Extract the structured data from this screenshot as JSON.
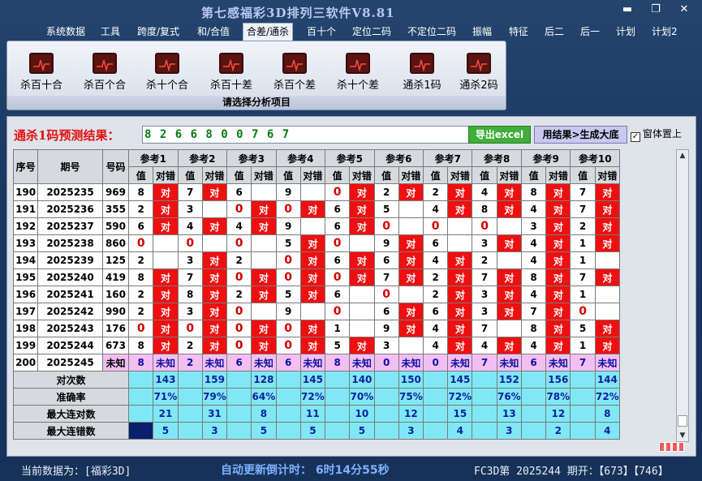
{
  "app": {
    "title": "第七感福彩3D排列三软件V8.81"
  },
  "window_controls": {
    "min": "▬",
    "max": "❐",
    "close": "✕"
  },
  "menu": [
    "系统数据",
    "工具",
    "跨度/复式",
    "和/合值",
    "合差/通杀",
    "百十个",
    "定位二码",
    "不定位二码",
    "振幅",
    "特征",
    "后二",
    "后一",
    "计划",
    "计划2"
  ],
  "ribbon": {
    "buttons": [
      "杀百十合",
      "杀百个合",
      "杀十个合",
      "杀百十差",
      "杀百个差",
      "杀十个差",
      "通杀1码",
      "通杀2码"
    ],
    "caption": "请选择分析项目"
  },
  "prediction": {
    "label": "通杀1码预测结果：",
    "value": "8 2 6 6 8 0 0 7 6 7",
    "export_label": "导出excel",
    "generate_label": "用结果>生成大底",
    "topmost_label": "窗体置上",
    "topmost_checked": "✓"
  },
  "table": {
    "headers": {
      "seq": "序号",
      "issue": "期号",
      "number": "号码",
      "value": "值",
      "hit": "对错"
    },
    "ref_titles": [
      "参考1",
      "参考2",
      "参考3",
      "参考4",
      "参考5",
      "参考6",
      "参考7",
      "参考8",
      "参考9",
      "参考10"
    ],
    "hit_mark": "对",
    "rows": [
      {
        "seq": "190",
        "issue": "2025235",
        "num": "969",
        "refs": [
          [
            "8",
            1
          ],
          [
            "7",
            1
          ],
          [
            "6",
            0
          ],
          [
            "9",
            0
          ],
          [
            "0",
            1
          ],
          [
            "2",
            1
          ],
          [
            "2",
            1
          ],
          [
            "4",
            1
          ],
          [
            "8",
            1
          ],
          [
            "7",
            1
          ]
        ]
      },
      {
        "seq": "191",
        "issue": "2025236",
        "num": "355",
        "refs": [
          [
            "2",
            1
          ],
          [
            "3",
            0
          ],
          [
            "0",
            1
          ],
          [
            "0",
            1
          ],
          [
            "6",
            1
          ],
          [
            "5",
            0
          ],
          [
            "4",
            1
          ],
          [
            "8",
            1
          ],
          [
            "4",
            1
          ],
          [
            "7",
            1
          ]
        ]
      },
      {
        "seq": "192",
        "issue": "2025237",
        "num": "590",
        "refs": [
          [
            "6",
            1
          ],
          [
            "4",
            1
          ],
          [
            "4",
            1
          ],
          [
            "9",
            0
          ],
          [
            "6",
            1
          ],
          [
            "0",
            0
          ],
          [
            "0",
            0
          ],
          [
            "0",
            0
          ],
          [
            "3",
            1
          ],
          [
            "2",
            1
          ]
        ]
      },
      {
        "seq": "193",
        "issue": "2025238",
        "num": "860",
        "refs": [
          [
            "0",
            0
          ],
          [
            "0",
            0
          ],
          [
            "0",
            0
          ],
          [
            "5",
            1
          ],
          [
            "0",
            0
          ],
          [
            "9",
            1
          ],
          [
            "6",
            0
          ],
          [
            "3",
            1
          ],
          [
            "4",
            1
          ],
          [
            "1",
            1
          ]
        ]
      },
      {
        "seq": "194",
        "issue": "2025239",
        "num": "125",
        "refs": [
          [
            "2",
            0
          ],
          [
            "3",
            1
          ],
          [
            "2",
            0
          ],
          [
            "0",
            1
          ],
          [
            "6",
            1
          ],
          [
            "6",
            1
          ],
          [
            "4",
            1
          ],
          [
            "2",
            0
          ],
          [
            "4",
            1
          ],
          [
            "1",
            0
          ]
        ]
      },
      {
        "seq": "195",
        "issue": "2025240",
        "num": "419",
        "refs": [
          [
            "8",
            1
          ],
          [
            "7",
            1
          ],
          [
            "0",
            1
          ],
          [
            "0",
            1
          ],
          [
            "0",
            1
          ],
          [
            "7",
            1
          ],
          [
            "2",
            1
          ],
          [
            "7",
            1
          ],
          [
            "8",
            1
          ],
          [
            "7",
            1
          ]
        ]
      },
      {
        "seq": "196",
        "issue": "2025241",
        "num": "160",
        "refs": [
          [
            "2",
            1
          ],
          [
            "8",
            1
          ],
          [
            "2",
            1
          ],
          [
            "5",
            1
          ],
          [
            "6",
            0
          ],
          [
            "0",
            0
          ],
          [
            "2",
            1
          ],
          [
            "3",
            1
          ],
          [
            "4",
            1
          ],
          [
            "1",
            0
          ]
        ]
      },
      {
        "seq": "197",
        "issue": "2025242",
        "num": "990",
        "refs": [
          [
            "2",
            1
          ],
          [
            "3",
            1
          ],
          [
            "0",
            0
          ],
          [
            "9",
            0
          ],
          [
            "0",
            0
          ],
          [
            "6",
            1
          ],
          [
            "6",
            1
          ],
          [
            "3",
            1
          ],
          [
            "7",
            1
          ],
          [
            "0",
            0
          ]
        ]
      },
      {
        "seq": "198",
        "issue": "2025243",
        "num": "176",
        "refs": [
          [
            "0",
            1
          ],
          [
            "0",
            1
          ],
          [
            "0",
            1
          ],
          [
            "0",
            1
          ],
          [
            "1",
            0
          ],
          [
            "9",
            1
          ],
          [
            "4",
            1
          ],
          [
            "7",
            0
          ],
          [
            "8",
            1
          ],
          [
            "5",
            1
          ]
        ]
      },
      {
        "seq": "199",
        "issue": "2025244",
        "num": "673",
        "refs": [
          [
            "8",
            1
          ],
          [
            "2",
            1
          ],
          [
            "0",
            1
          ],
          [
            "0",
            1
          ],
          [
            "5",
            1
          ],
          [
            "3",
            0
          ],
          [
            "4",
            1
          ],
          [
            "4",
            1
          ],
          [
            "4",
            1
          ],
          [
            "1",
            1
          ]
        ]
      }
    ],
    "pending": {
      "seq": "200",
      "issue": "2025245",
      "num": "未知",
      "unknown": "未知",
      "values": [
        "8",
        "2",
        "6",
        "6",
        "8",
        "0",
        "0",
        "7",
        "6",
        "7"
      ]
    },
    "stats": [
      {
        "label": "对次数",
        "values": [
          "143",
          "159",
          "128",
          "145",
          "140",
          "150",
          "145",
          "152",
          "156",
          "144"
        ]
      },
      {
        "label": "准确率",
        "values": [
          "71%",
          "79%",
          "64%",
          "72%",
          "70%",
          "75%",
          "72%",
          "76%",
          "78%",
          "72%"
        ]
      },
      {
        "label": "最大连对数",
        "values": [
          "21",
          "31",
          "8",
          "11",
          "10",
          "12",
          "15",
          "13",
          "12",
          "8"
        ]
      },
      {
        "label": "最大连错数",
        "values": [
          "5",
          "3",
          "5",
          "5",
          "5",
          "3",
          "4",
          "3",
          "2",
          "4"
        ]
      }
    ]
  },
  "status": {
    "current_data": "当前数据为：[福彩3D]",
    "countdown": "自动更新倒计时： 6时14分55秒",
    "latest": "FC3D第 2025244 期开：【673】【746】"
  }
}
